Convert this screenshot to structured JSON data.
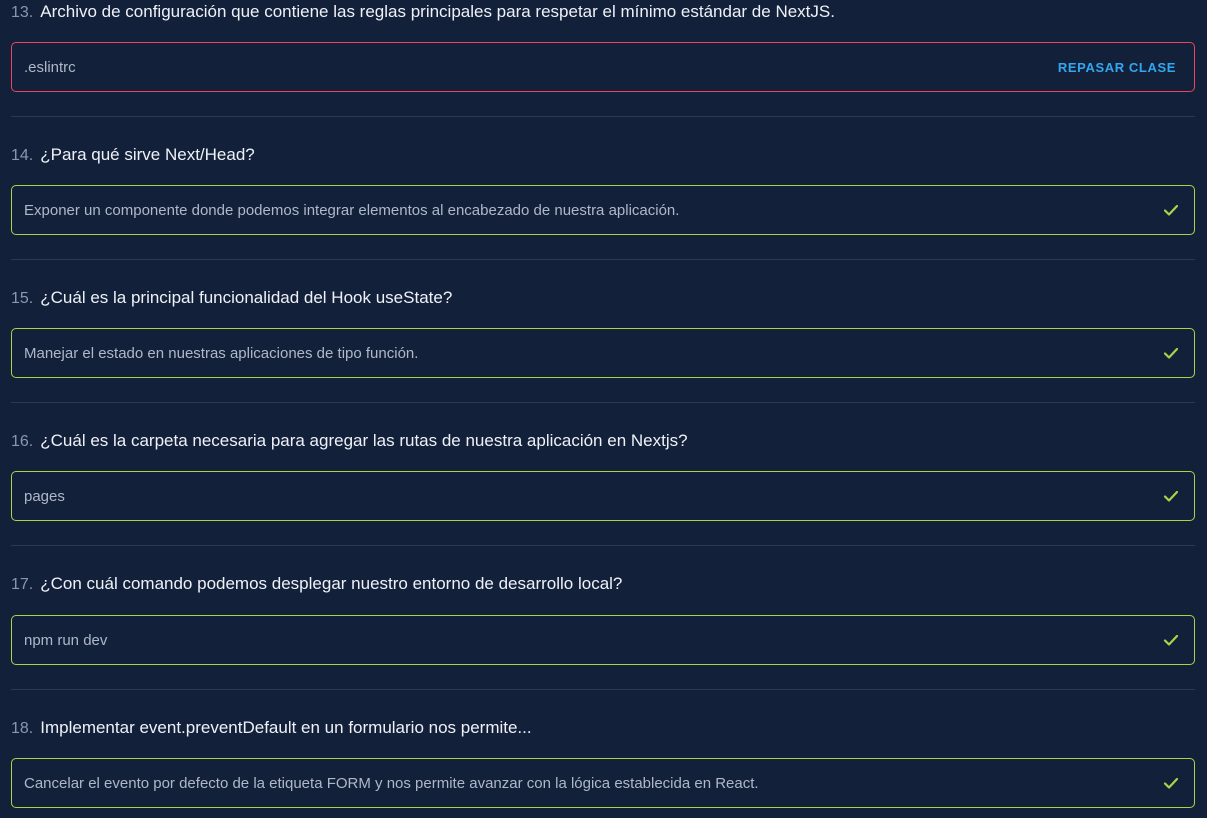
{
  "questions": [
    {
      "number": "13.",
      "question": "Archivo de configuración que contiene las reglas principales para respetar el mínimo estándar de NextJS.",
      "answer": ".eslintrc",
      "status": "incorrect",
      "review_label": "REPASAR CLASE"
    },
    {
      "number": "14.",
      "question": "¿Para qué sirve Next/Head?",
      "answer": "Exponer un componente donde podemos integrar elementos al encabezado de nuestra aplicación.",
      "status": "correct"
    },
    {
      "number": "15.",
      "question": "¿Cuál es la principal funcionalidad del Hook useState?",
      "answer": "Manejar el estado en nuestras aplicaciones de tipo función.",
      "status": "correct"
    },
    {
      "number": "16.",
      "question": "¿Cuál es la carpeta necesaria para agregar las rutas de nuestra aplicación en Nextjs?",
      "answer": "pages",
      "status": "correct"
    },
    {
      "number": "17.",
      "question": "¿Con cuál comando podemos desplegar nuestro entorno de desarrollo local?",
      "answer": "npm run dev",
      "status": "correct"
    },
    {
      "number": "18.",
      "question": "Implementar event.preventDefault en un formulario nos permite...",
      "answer": "Cancelar el evento por defecto de la etiqueta FORM y nos permite avanzar con la lógica establecida en React.",
      "status": "correct"
    }
  ],
  "colors": {
    "background": "#13203a",
    "correct_border": "#a9d44a",
    "incorrect_border": "#e8455f",
    "review_link": "#33a6f0"
  },
  "icons": {
    "correct": "check-icon"
  }
}
